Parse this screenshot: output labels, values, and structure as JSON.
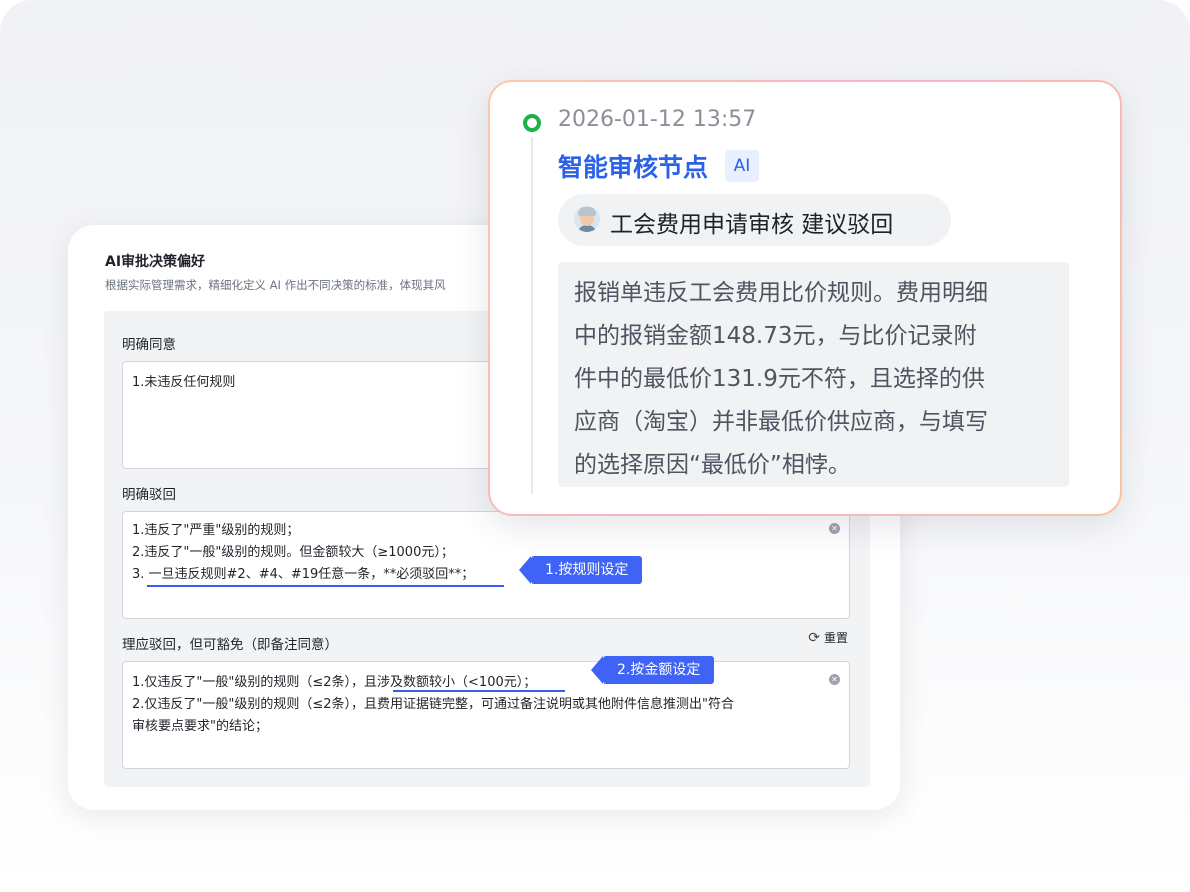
{
  "preference_card": {
    "title": "AI审批决策偏好",
    "subtitle": "根据实际管理需求，精细化定义 AI 作出不同决策的标准，体现其风",
    "sections": [
      {
        "label": "明确同意",
        "lines": [
          "1.未违反任何规则"
        ]
      },
      {
        "label": "明确驳回",
        "lines": [
          "1.违反了\"严重\"级别的规则；",
          "2.违反了\"一般\"级别的规则。但金额较大（≥1000元）；",
          "3. 一旦违反规则#2、#4、#19任意一条，**必须驳回**；"
        ]
      },
      {
        "label": "理应驳回，但可豁免（即备注同意）",
        "lines": [
          "1.仅违反了\"一般\"级别的规则（≤2条），且涉及数额较小（<100元）；",
          "2.仅违反了\"一般\"级别的规则（≤2条），且费用证据链完整，可通过备注说明或其他附件信息推测出\"符合",
          "审核要点要求\"的结论；"
        ]
      }
    ],
    "reset_label": "重置",
    "tags": [
      "1.按规则设定",
      "2.按金额设定"
    ]
  },
  "ai_card": {
    "timestamp": "2026-01-12 13:57",
    "node_title": "智能审核节点",
    "ai_badge": "AI",
    "verdict": "工会费用申请审核 建议驳回",
    "reason_lines": [
      "报销单违反工会费用比价规则。费用明细",
      "中的报销金额148.73元，与比价记录附",
      "件中的最低价131.9元不符，且选择的供",
      "应商（淘宝）并非最低价供应商，与填写",
      "的选择原因“最低价”相悖。"
    ]
  },
  "colors": {
    "accent_blue": "#3f63f5",
    "title_blue": "#2b62e8",
    "status_green": "#19b24b"
  }
}
